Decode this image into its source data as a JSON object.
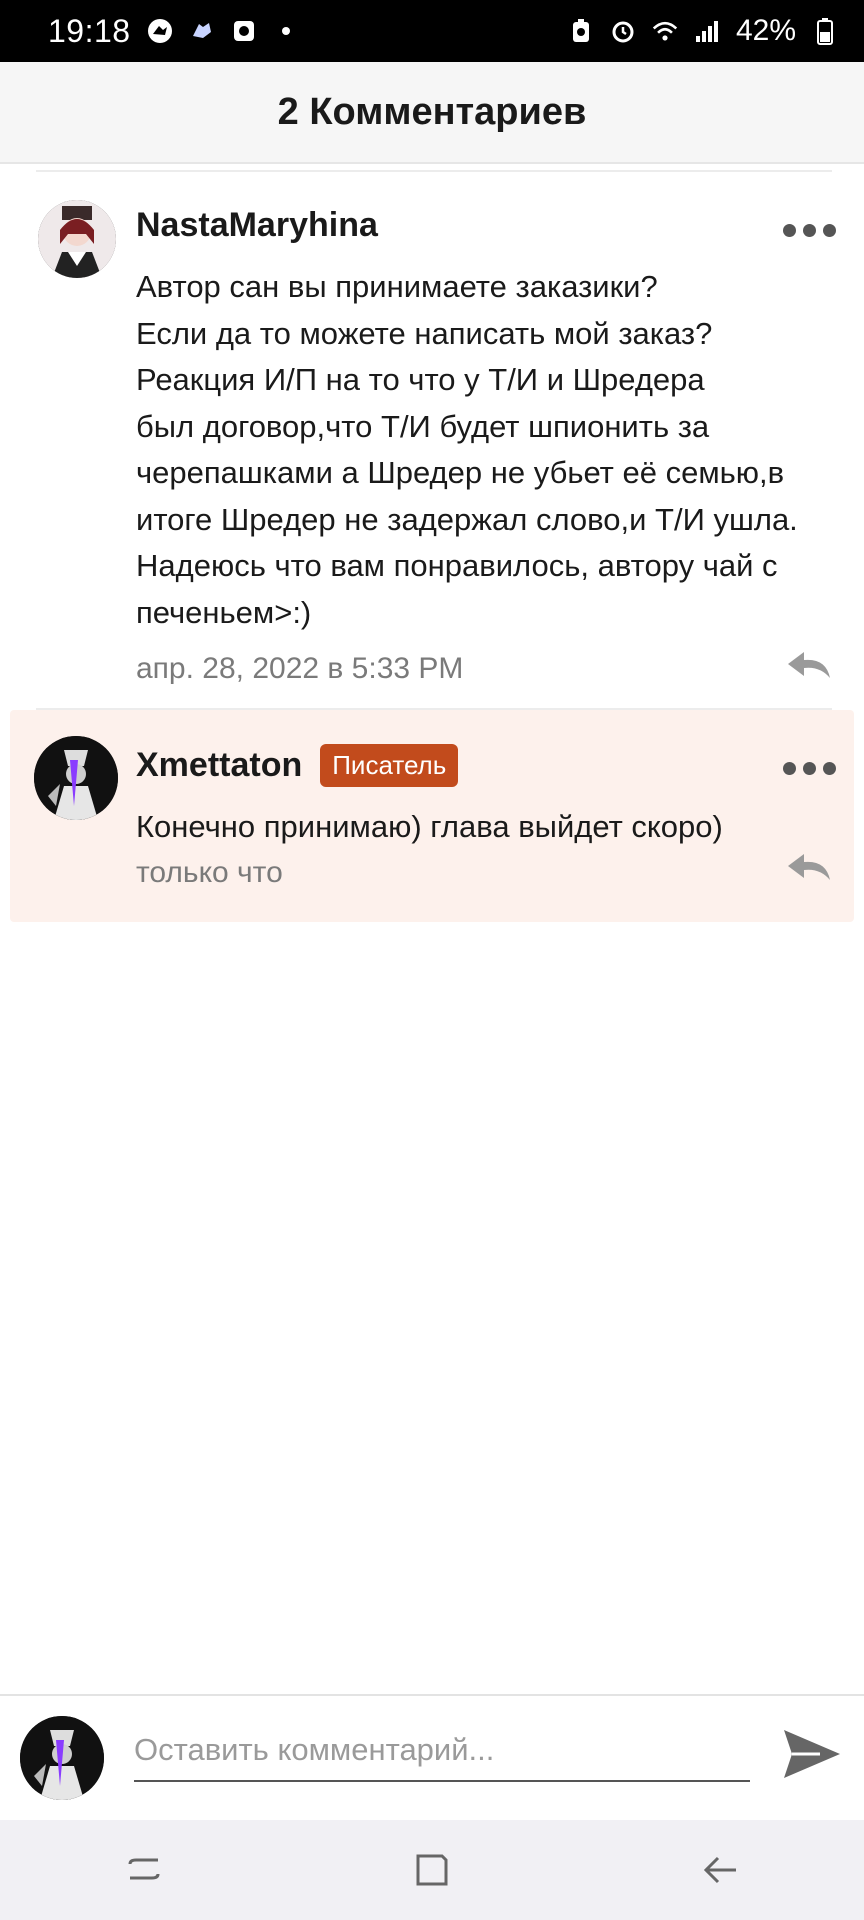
{
  "status_bar": {
    "time": "19:18",
    "battery": "42%",
    "icons": [
      "dinosaur-icon",
      "gamepad-icon",
      "media-icon",
      "notification-dot-icon",
      "battery-saver-icon",
      "alarm-icon",
      "wifi-icon",
      "signal-icon",
      "battery-icon"
    ]
  },
  "header": {
    "title": "2 Комментариев"
  },
  "comments": [
    {
      "author": "NastaMaryhina",
      "text": "Автор сан вы принимаете заказики?\nЕсли да то можете написать мой заказ?\nРеакция И/П на то что у Т/И и Шредера\nбыл договор,что Т/И будет шпионить за\nчерепашками а Шредер не убьет её семью,в\nитоге Шредер не задержал слово,и Т/И ушла.\nНадеюсь что вам понравилось, автору чай с\nпеченьем>:)",
      "time": "апр. 28, 2022 в 5:33 PM"
    },
    {
      "author": "Xmettaton",
      "badge": "Писатель",
      "text": "Конечно принимаю) глава выйдет скоро)",
      "time": "только что"
    }
  ],
  "input": {
    "placeholder": "Оставить комментарий..."
  },
  "colors": {
    "badge": "#c24b1c",
    "reply_bg": "#fdf1ec",
    "header_bg": "#f6f6f6"
  }
}
